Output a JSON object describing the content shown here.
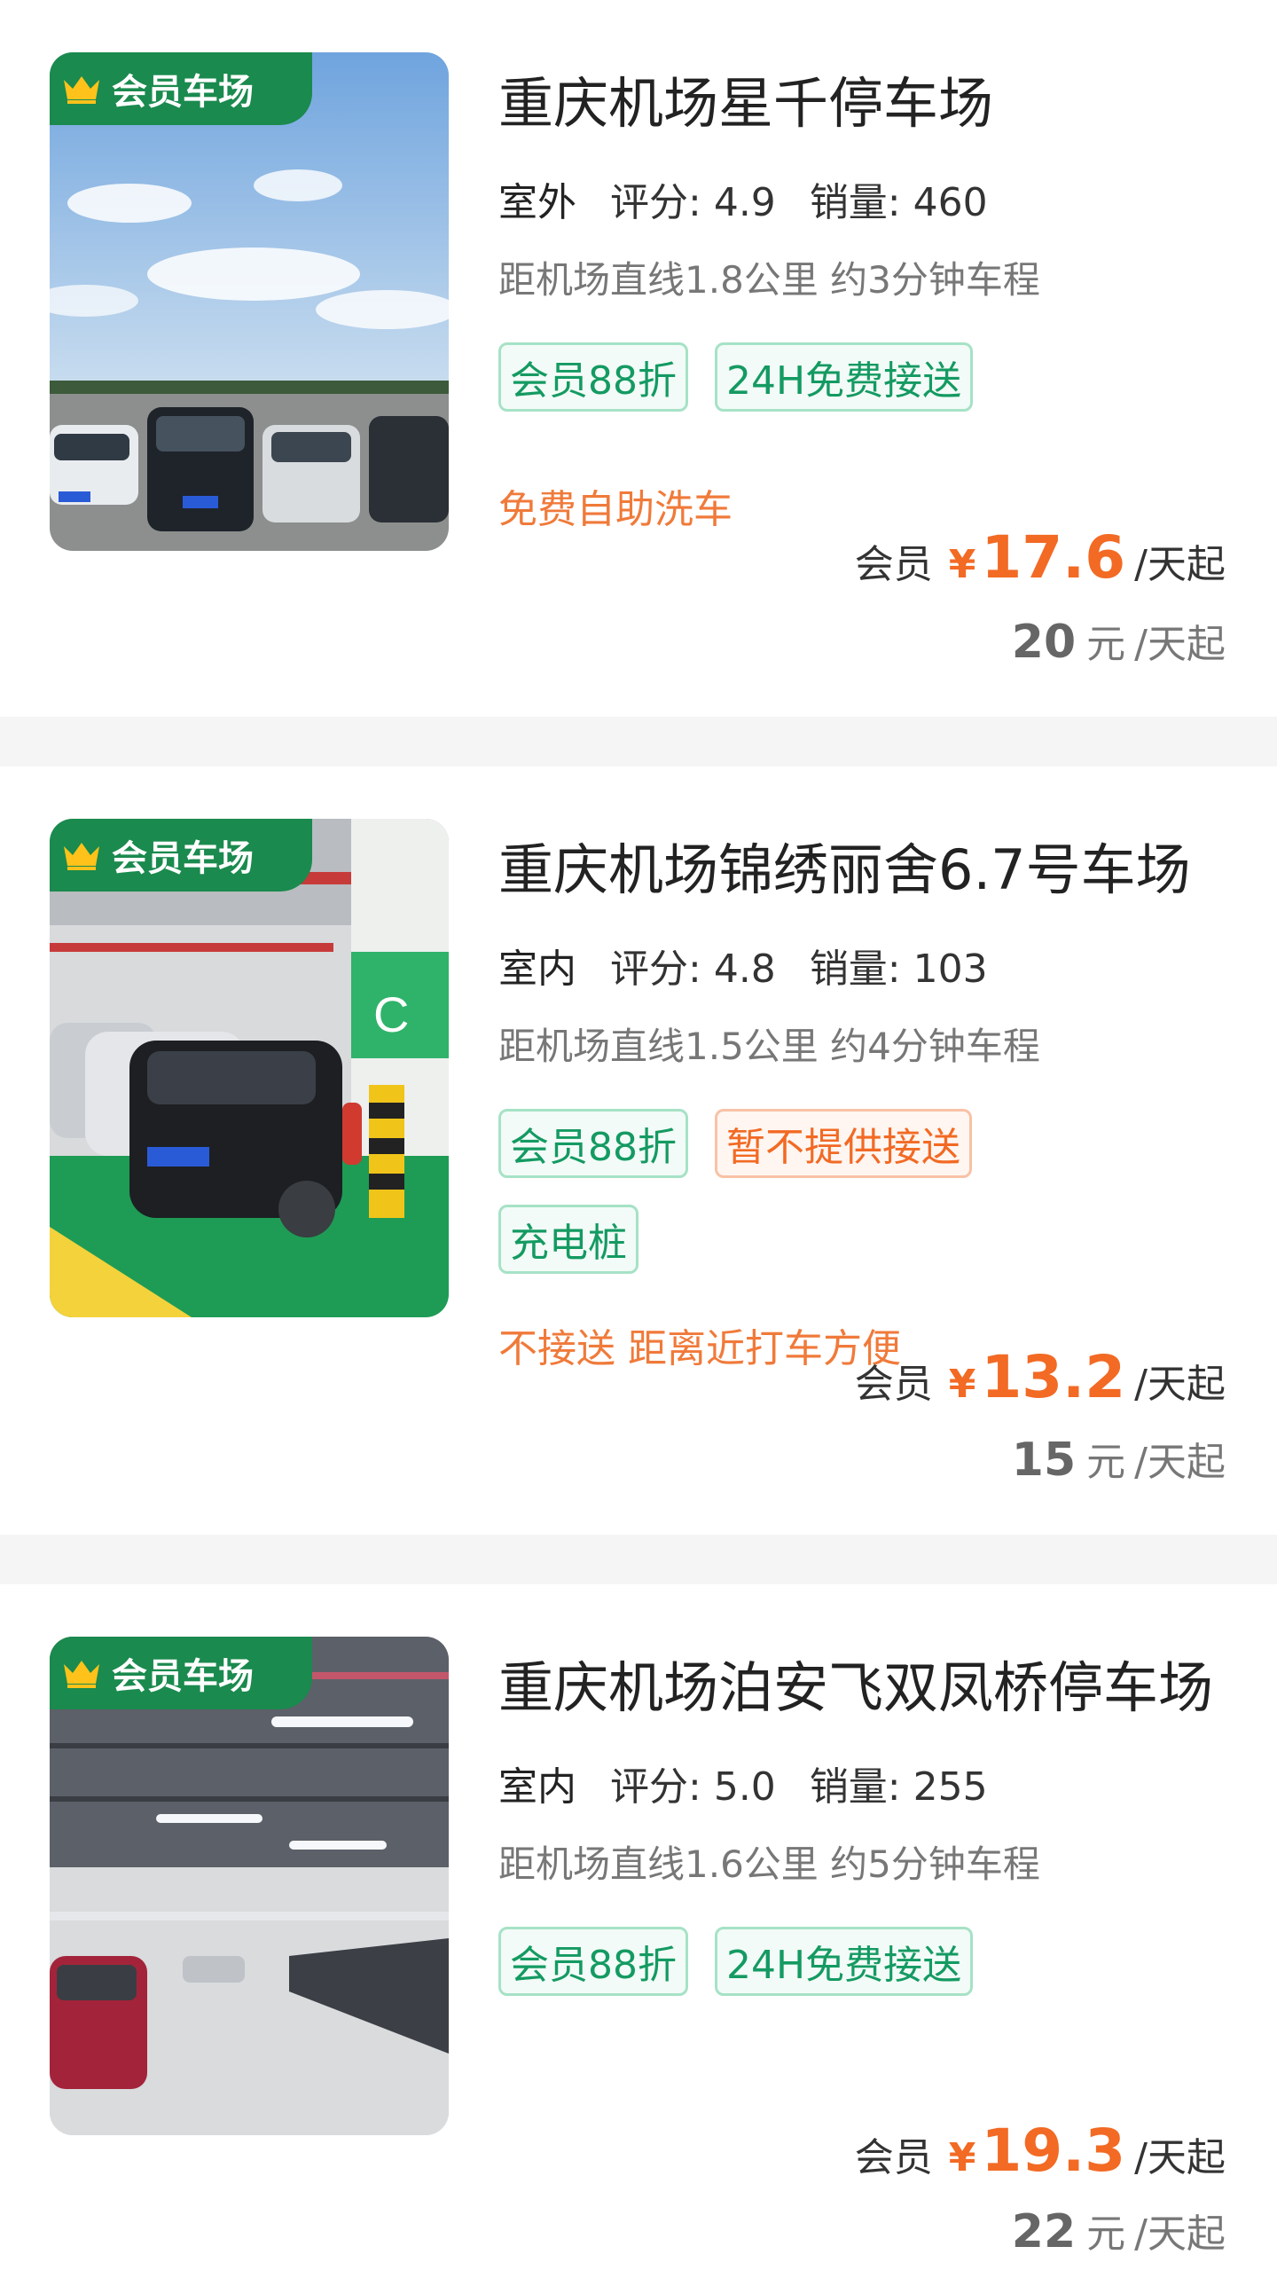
{
  "lots": [
    {
      "badge": "会员车场",
      "name": "重庆机场星千停车场",
      "env": "室外",
      "rating_label": "评分:",
      "rating": "4.9",
      "sales_label": "销量:",
      "sales": "460",
      "distance": "距机场直线1.8公里 约3分钟车程",
      "tags": [
        {
          "label": "会员88折",
          "style": "green"
        },
        {
          "label": "24H免费接送",
          "style": "green"
        }
      ],
      "feature": "免费自助洗车",
      "member_label": "会员",
      "currency": "¥",
      "member_price": "17.6",
      "price_unit": "/天起",
      "orig_price": "20",
      "orig_currency": "元",
      "orig_unit": "/天起",
      "photo_icon": "outdoor-parking-photo"
    },
    {
      "badge": "会员车场",
      "name": "重庆机场锦绣丽舍6.7号车场",
      "env": "室内",
      "rating_label": "评分:",
      "rating": "4.8",
      "sales_label": "销量:",
      "sales": "103",
      "distance": "距机场直线1.5公里 约4分钟车程",
      "tags": [
        {
          "label": "会员88折",
          "style": "green"
        },
        {
          "label": "暂不提供接送",
          "style": "orange"
        },
        {
          "label": "充电桩",
          "style": "green"
        }
      ],
      "feature": "不接送 距离近打车方便",
      "member_label": "会员",
      "currency": "¥",
      "member_price": "13.2",
      "price_unit": "/天起",
      "orig_price": "15",
      "orig_currency": "元",
      "orig_unit": "/天起",
      "photo_icon": "indoor-garage-photo"
    },
    {
      "badge": "会员车场",
      "name": "重庆机场泊安飞双凤桥停车场",
      "env": "室内",
      "rating_label": "评分:",
      "rating": "5.0",
      "sales_label": "销量:",
      "sales": "255",
      "distance": "距机场直线1.6公里 约5分钟车程",
      "tags": [
        {
          "label": "会员88折",
          "style": "green"
        },
        {
          "label": "24H免费接送",
          "style": "green"
        }
      ],
      "feature": "",
      "member_label": "会员",
      "currency": "¥",
      "member_price": "19.3",
      "price_unit": "/天起",
      "orig_price": "22",
      "orig_currency": "元",
      "orig_unit": "/天起",
      "photo_icon": "indoor-garage-photo"
    }
  ],
  "colors": {
    "brand_green": "#1a8a4e",
    "price_orange": "#f26a24",
    "tag_green": "#149a62",
    "separator": "#f5f5f5"
  }
}
